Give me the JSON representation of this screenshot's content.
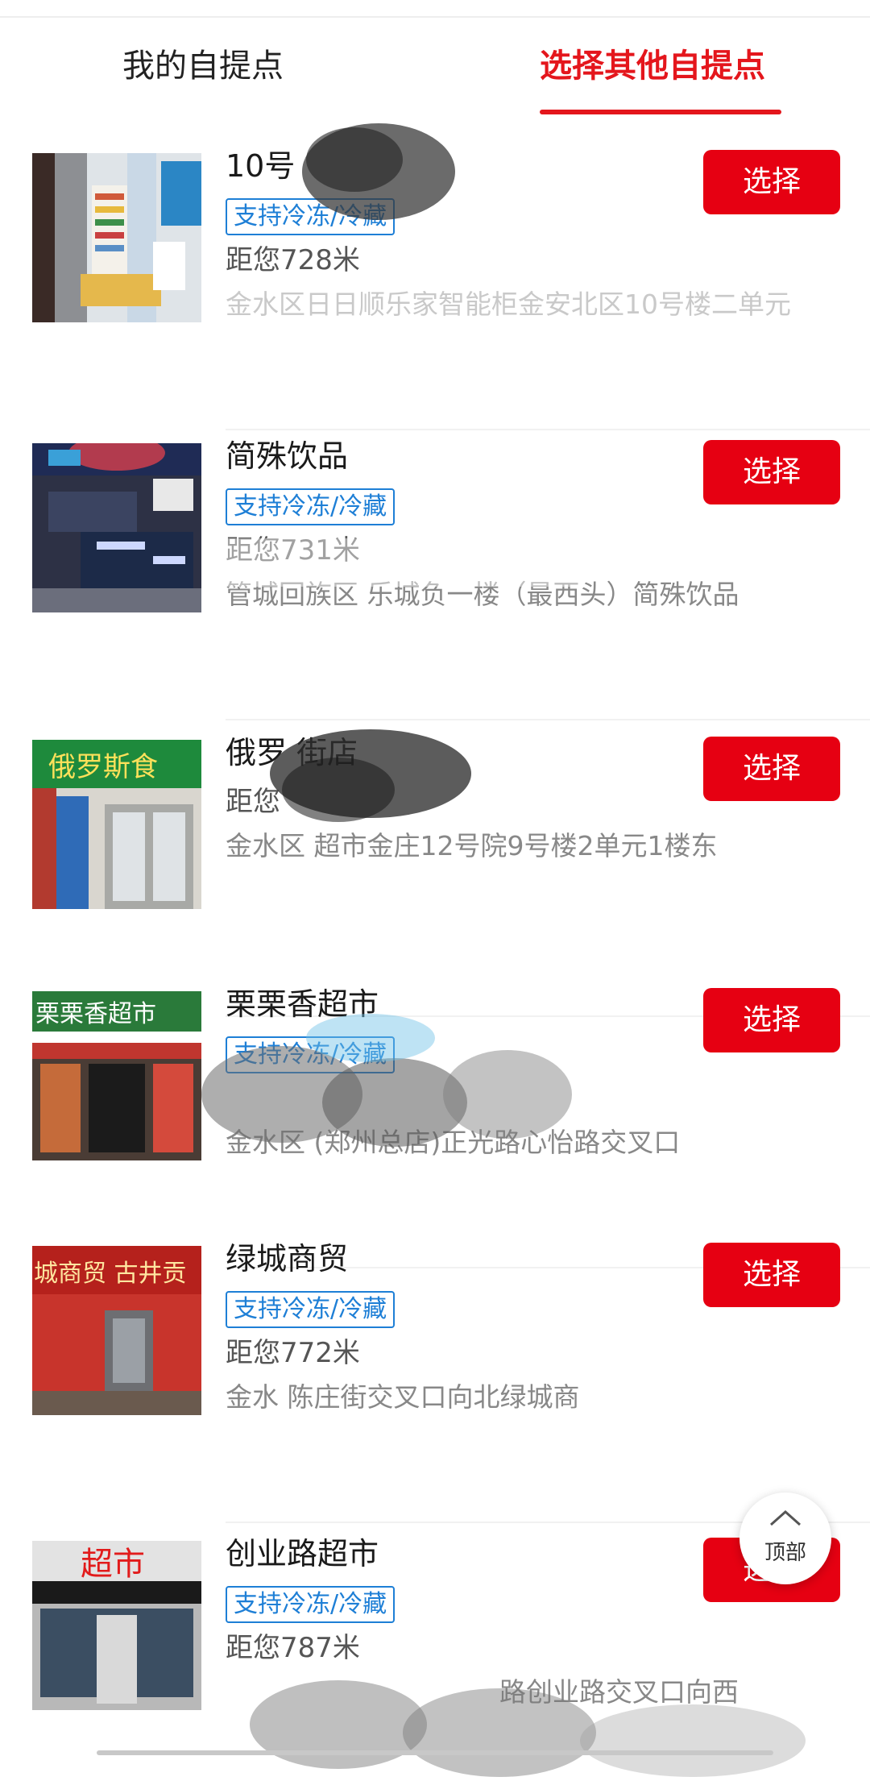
{
  "tabs": {
    "mine": "我的自提点",
    "other": "选择其他自提点",
    "active": "other"
  },
  "items": [
    {
      "name": "10号",
      "badge": "支持冷冻/冷藏",
      "distance": "距您728米",
      "address": "金水区日日顺乐家智能柜金安北区10号楼二单元",
      "button": "选择"
    },
    {
      "name": "简殊饮品",
      "badge": "支持冷冻/冷藏",
      "distance": "距您731米",
      "address": "管城回族区 乐城负一楼（最西头）简殊饮品",
      "button": "选择"
    },
    {
      "name": "俄罗 街店",
      "badge": "",
      "distance": "距您",
      "address": "金水区 超市金庄12号院9号楼2单元1楼东",
      "button": "选择"
    },
    {
      "name": "栗栗香超市",
      "badge": "支持冷冻/冷藏",
      "distance": "",
      "address": "金水区 (郑州总店)正光路心怡路交叉口",
      "button": "选择"
    },
    {
      "name": "绿城商贸",
      "badge": "支持冷冻/冷藏",
      "distance": "距您772米",
      "address": "金水 陈庄街交叉口向北绿城商",
      "button": "选择"
    },
    {
      "name": "创业路超市",
      "badge": "支持冷冻/冷藏",
      "distance": "距您787米",
      "address": "路创业路交叉口向西",
      "button": "选择"
    }
  ],
  "thumb_signs": [
    "",
    "",
    "俄罗斯食",
    "栗栗香超市",
    "城商贸 古井贡",
    "超市"
  ],
  "back_to_top": "顶部",
  "colors": {
    "accent": "#e4161c",
    "button": "#e60012",
    "badge": "#1e7fd6"
  }
}
